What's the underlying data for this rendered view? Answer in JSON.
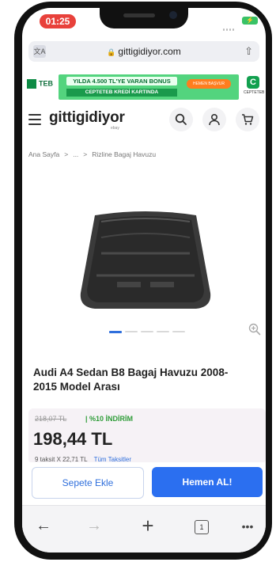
{
  "status_bar": {
    "time": "01:25",
    "battery_label": "⚡"
  },
  "browser": {
    "url": "gittigidiyor.com",
    "lock_glyph": "🔒",
    "share_glyph": "⇧",
    "translate_glyph": "文A"
  },
  "banner": {
    "bank_name": "TEB",
    "promo_top": "YILDA 4.500 TL'YE VARAN BONUS",
    "promo_sub": "CEPTETEB KREDİ KARTINDA",
    "promo_button": "HEMEN BAŞVUR",
    "app_logo": "C",
    "app_caption": "CEPTETEB"
  },
  "site": {
    "logo": "gittigidiyor",
    "logo_sub": "ebay"
  },
  "breadcrumb": [
    "Ana Sayfa",
    ">",
    "...",
    ">",
    "Rizline Bagaj Havuzu"
  ],
  "product": {
    "title": "Audi A4 Sedan B8 Bagaj Havuzu 2008-2015 Model Arası",
    "old_price": "218,07 TL",
    "discount": "| %10 İNDİRİM",
    "price": "198,44 TL",
    "installment": "9 taksit X 22,71 TL",
    "all_installments": "Tüm Taksitler",
    "gallery_count": 5,
    "gallery_active": 0
  },
  "actions": {
    "add_to_cart": "Sepete Ekle",
    "buy_now": "Hemen AL!"
  },
  "bottom_nav": {
    "back": "←",
    "forward": "→",
    "new_tab": "+",
    "tabs_count": "1",
    "more": "•••"
  },
  "colors": {
    "accent": "#2b6ff0",
    "discount": "#2f9d39",
    "time_pill": "#e8413b"
  }
}
